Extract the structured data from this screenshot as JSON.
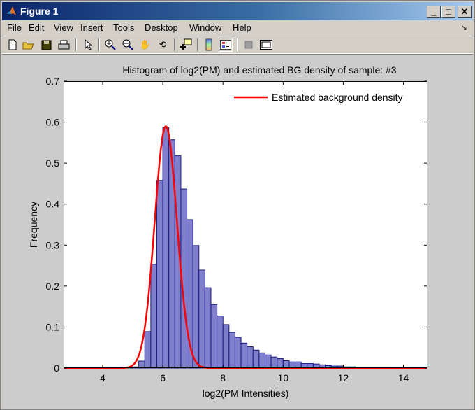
{
  "window": {
    "title": "Figure 1",
    "minimize_icon": "minimize-icon",
    "maximize_icon": "maximize-icon",
    "close_icon": "close-icon"
  },
  "menu": {
    "items": [
      "File",
      "Edit",
      "View",
      "Insert",
      "Tools",
      "Desktop",
      "Window",
      "Help"
    ]
  },
  "toolbar": {
    "icons": [
      "new-figure-icon",
      "open-file-icon",
      "save-icon",
      "print-icon",
      "select-arrow-icon",
      "zoom-in-icon",
      "zoom-out-icon",
      "pan-hand-icon",
      "rotate-3d-icon",
      "data-cursor-icon",
      "colorbar-icon",
      "legend-icon",
      "hide-plot-tools-icon",
      "show-plot-tools-icon"
    ]
  },
  "colors": {
    "bar_fill": "#7f7fcc",
    "bar_edge": "#1a1a80",
    "curve": "#ff0000",
    "axes_bg": "#ffffff",
    "figure_bg": "#cccccc"
  },
  "chart_data": {
    "type": "bar",
    "title": "Histogram of log2(PM) and estimated BG density of sample: #3",
    "xlabel": "log2(PM Intensities)",
    "ylabel": "Frequency",
    "xlim": [
      2.7,
      14.8
    ],
    "ylim": [
      0,
      0.7
    ],
    "xticks": [
      4,
      6,
      8,
      10,
      12,
      14
    ],
    "yticks": [
      0,
      0.1,
      0.2,
      0.3,
      0.4,
      0.5,
      0.6,
      0.7
    ],
    "ytick_labels": [
      "0",
      "0.1",
      "0.2",
      "0.3",
      "0.4",
      "0.5",
      "0.6",
      "0.7"
    ],
    "grid": false,
    "histogram": {
      "bin_start": 4.8,
      "bin_width": 0.2,
      "values": [
        0.001,
        0.003,
        0.017,
        0.089,
        0.253,
        0.458,
        0.587,
        0.557,
        0.518,
        0.437,
        0.362,
        0.299,
        0.239,
        0.196,
        0.155,
        0.127,
        0.106,
        0.087,
        0.075,
        0.061,
        0.052,
        0.044,
        0.037,
        0.032,
        0.027,
        0.023,
        0.018,
        0.015,
        0.015,
        0.011,
        0.011,
        0.01,
        0.008,
        0.006,
        0.005,
        0.005,
        0.003,
        0.003,
        0.001,
        0.001,
        0.001,
        0.001,
        0.001,
        0.001
      ]
    },
    "series": [
      {
        "name": "Estimated background density",
        "type": "line",
        "model": "gaussian",
        "mean": 6.1,
        "sd": 0.37,
        "peak": 0.59,
        "x_range": [
          2.7,
          14.8
        ]
      }
    ],
    "legend": {
      "entries": [
        "Estimated background density"
      ],
      "placement": "top-right"
    }
  }
}
